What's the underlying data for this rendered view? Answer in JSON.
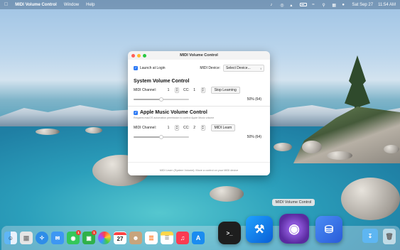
{
  "menubar": {
    "app_name": "MIDI Volume Control",
    "menus": [
      "Window",
      "Help"
    ],
    "date": "Sat Sep 27",
    "time": "11:54 AM"
  },
  "window": {
    "title": "MIDI Volume Control",
    "launch_at_login": "Launch at Login",
    "midi_device_label": "MIDI Device:",
    "midi_device_value": "Select Device...",
    "system": {
      "title": "System Volume Control",
      "channel_label": "MIDI Channel:",
      "channel_value": "1",
      "cc_label": "CC:",
      "cc_value": "1",
      "button": "Stop Learning",
      "volume_text": "50% (64)",
      "volume_fraction": 0.5
    },
    "apple_music": {
      "title": "Apple Music Volume Control",
      "description": "Requires macOS automation permission to control Apple Music volume",
      "channel_label": "MIDI Channel:",
      "channel_value": "1",
      "cc_label": "CC:",
      "cc_value": "2",
      "button": "MIDI Learn",
      "volume_text": "50% (64)",
      "volume_fraction": 0.5
    },
    "footer": "MIDI Learn (System Volume): Move a control on your MIDI device"
  },
  "tooltip": "MIDI Volume Control",
  "dock": {
    "calendar_day": "27",
    "messages_badge": "1",
    "facetime_badge": "1"
  },
  "colors": {
    "accent": "#2f7bf5",
    "badge": "#e94335"
  }
}
